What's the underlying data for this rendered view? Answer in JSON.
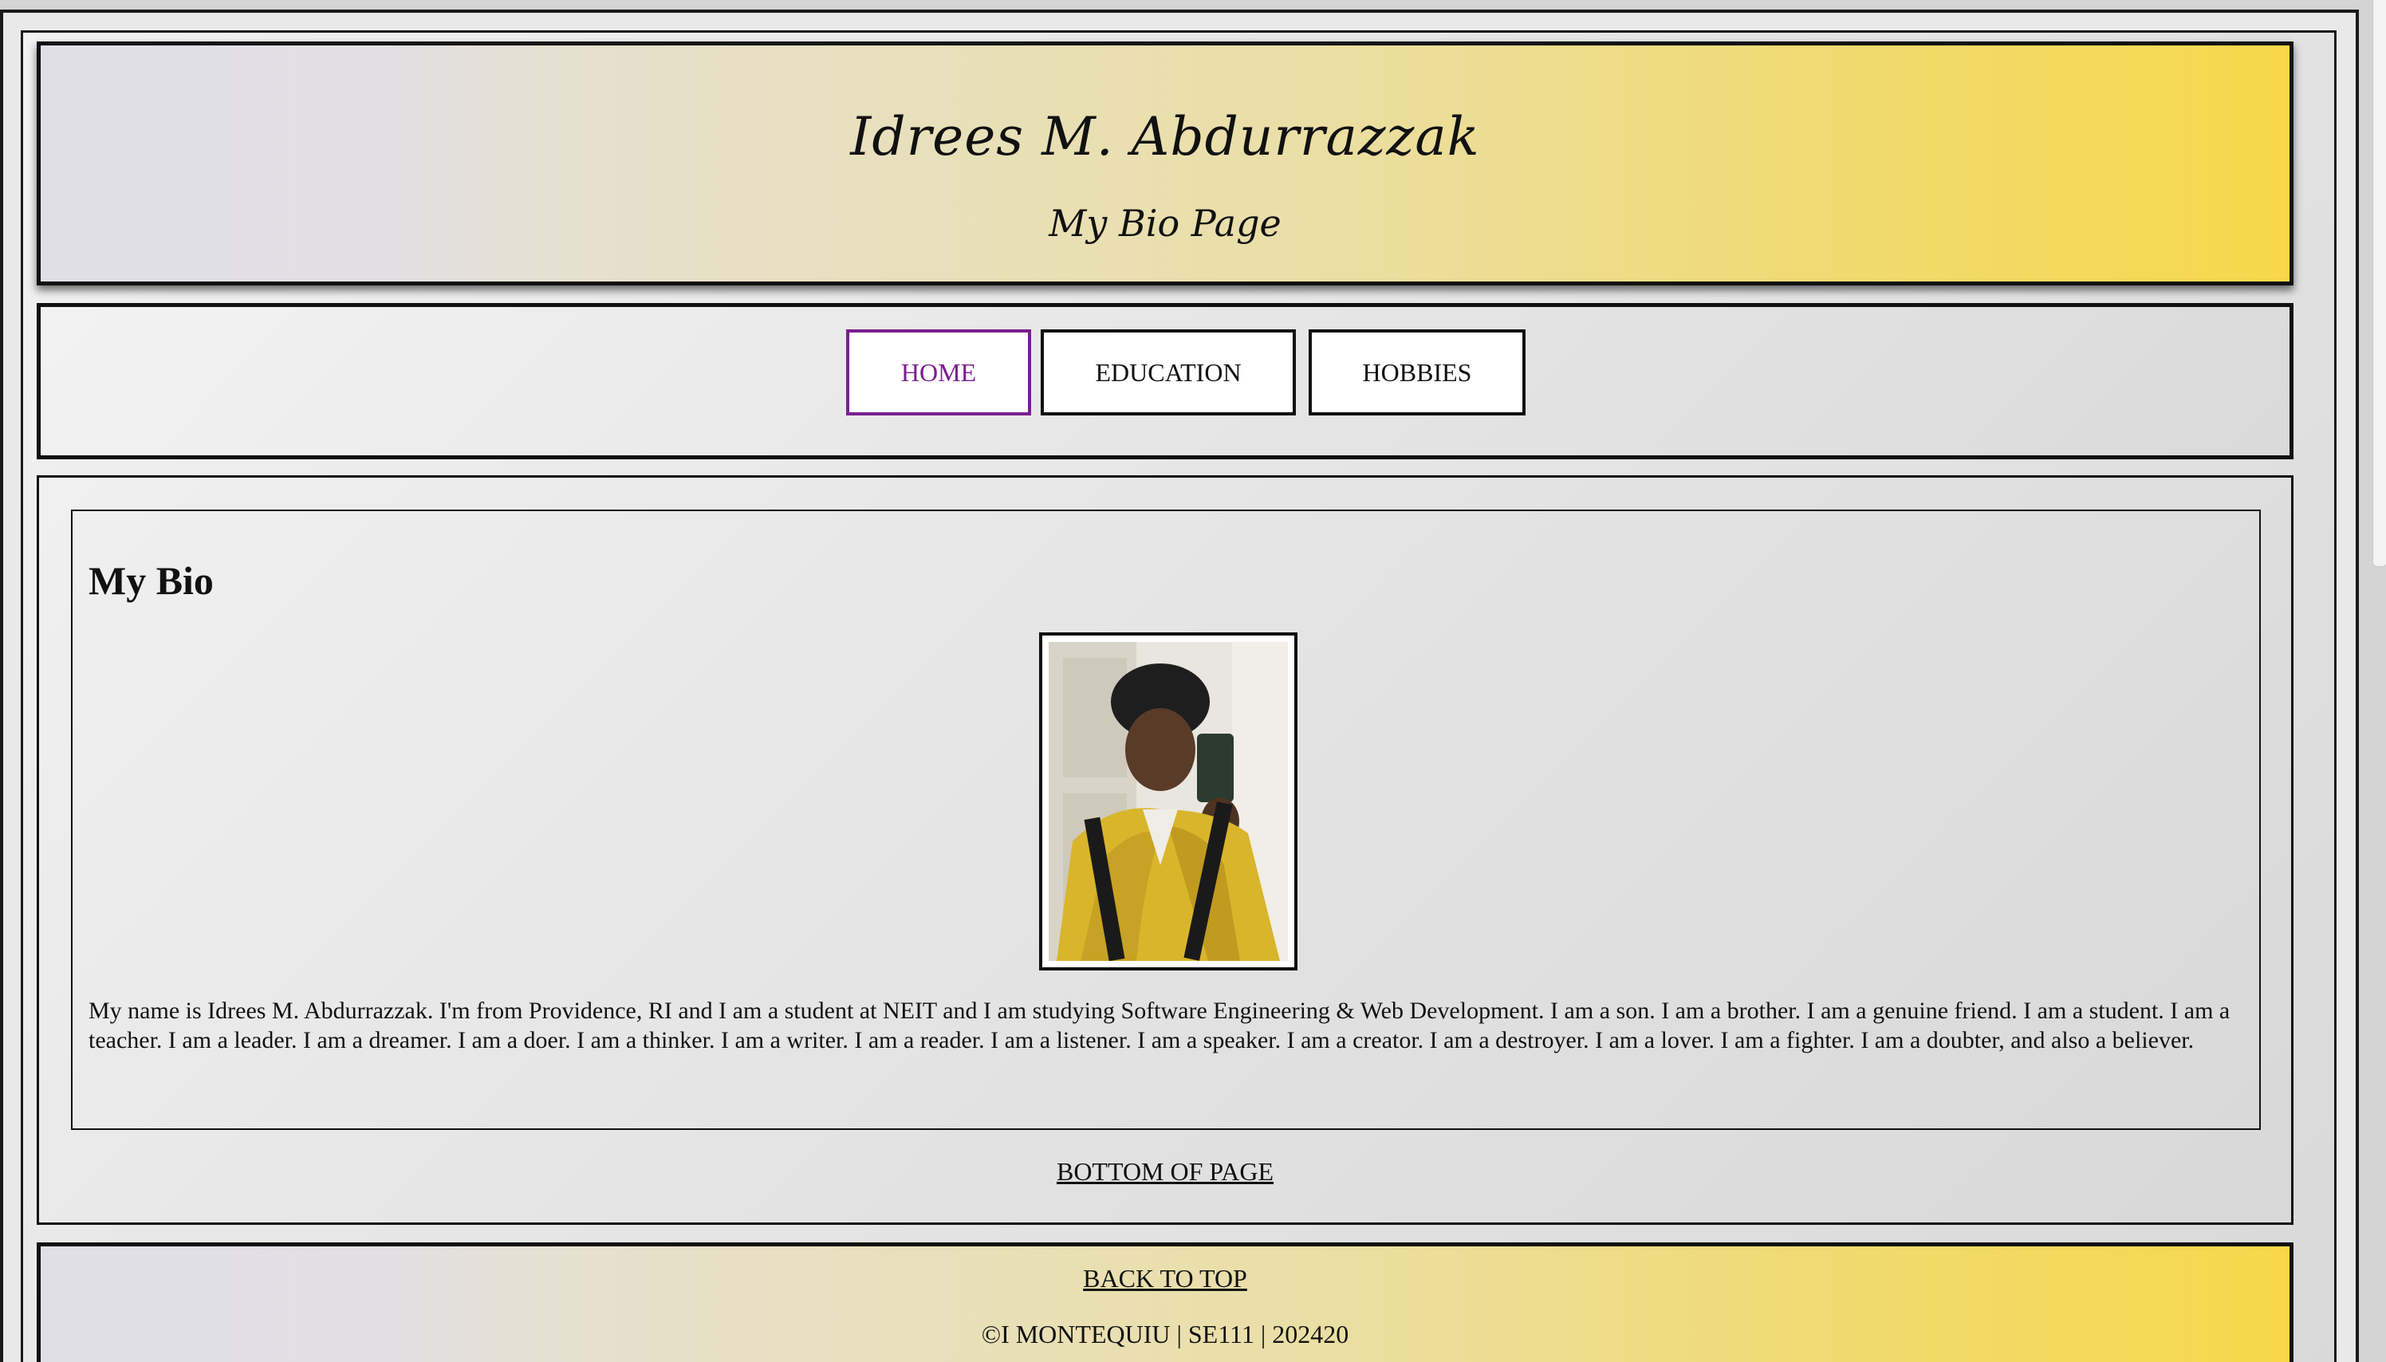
{
  "header": {
    "title": "Idrees M. Abdurrazzak",
    "subtitle": "My Bio Page"
  },
  "nav": {
    "items": [
      {
        "label": "HOME",
        "active": true
      },
      {
        "label": "EDUCATION",
        "active": false
      },
      {
        "label": "HOBBIES",
        "active": false
      }
    ]
  },
  "main": {
    "heading": "My Bio",
    "bio": "My name is Idrees M. Abdurrazzak. I'm from Providence, RI and I am a student at NEIT and I am studying Software Engineering & Web Development. I am a son. I am a brother. I am a genuine friend. I am a student. I am a teacher. I am a leader. I am a dreamer. I am a doer. I am a thinker. I am a writer. I am a reader. I am a listener. I am a speaker. I am a creator. I am a destroyer. I am a lover. I am a fighter. I am a doubter, and also a believer.",
    "bottom_link": "BOTTOM OF PAGE"
  },
  "footer": {
    "back_to_top": "BACK TO TOP",
    "copyright": "©I MONTEQUIU | SE111 | 202420"
  },
  "colors": {
    "accent_active": "#7b1f8f",
    "header_gradient_start": "#e0dfe7",
    "header_gradient_end": "#f7d84a",
    "border": "#111111"
  }
}
